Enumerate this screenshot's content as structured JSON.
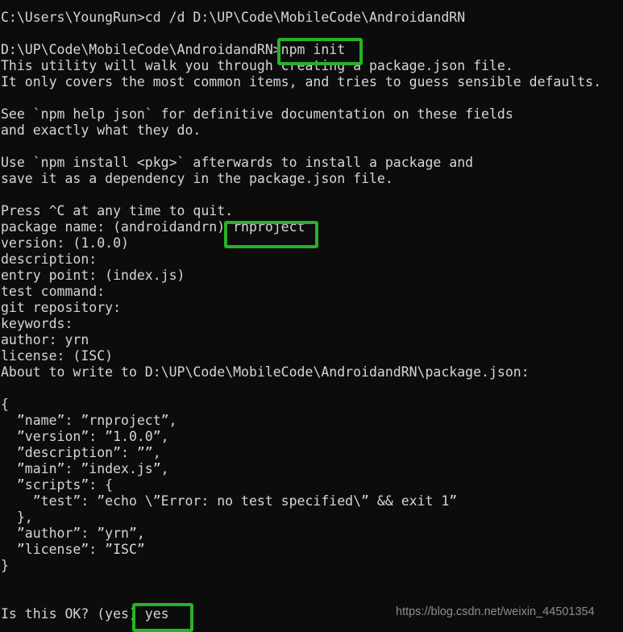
{
  "terminal": {
    "background_color": "#0c0c0c",
    "text_color": "#d6d6d6",
    "lines": [
      "C:\\Users\\YoungRun>cd /d D:\\UP\\Code\\MobileCode\\AndroidandRN",
      "",
      "D:\\UP\\Code\\MobileCode\\AndroidandRN>npm init",
      "This utility will walk you through creating a package.json file.",
      "It only covers the most common items, and tries to guess sensible defaults.",
      "",
      "See `npm help json` for definitive documentation on these fields",
      "and exactly what they do.",
      "",
      "Use `npm install <pkg>` afterwards to install a package and",
      "save it as a dependency in the package.json file.",
      "",
      "Press ^C at any time to quit.",
      "package name: (androidandrn) rnproject",
      "version: (1.0.0)",
      "description:",
      "entry point: (index.js)",
      "test command:",
      "git repository:",
      "keywords:",
      "author: yrn",
      "license: (ISC)",
      "About to write to D:\\UP\\Code\\MobileCode\\AndroidandRN\\package.json:",
      "",
      "{",
      "  ”name”: ”rnproject”,",
      "  ”version”: ”1.0.0”,",
      "  ”description”: ””,",
      "  ”main”: ”index.js”,",
      "  ”scripts”: {",
      "    ”test”: ”echo \\”Error: no test specified\\” && exit 1”",
      "  },",
      "  ”author”: ”yrn”,",
      "  ”license”: ”ISC”",
      "}",
      "",
      "",
      "Is this OK? (yes) yes"
    ]
  },
  "annotations": {
    "color": "#27b327",
    "boxes": [
      {
        "name": "npm-init",
        "label": "npm init"
      },
      {
        "name": "rnproject",
        "label": "rnproject"
      },
      {
        "name": "yes",
        "label": "yes"
      }
    ]
  },
  "watermark": {
    "text": "https://blog.csdn.net/weixin_44501354"
  }
}
